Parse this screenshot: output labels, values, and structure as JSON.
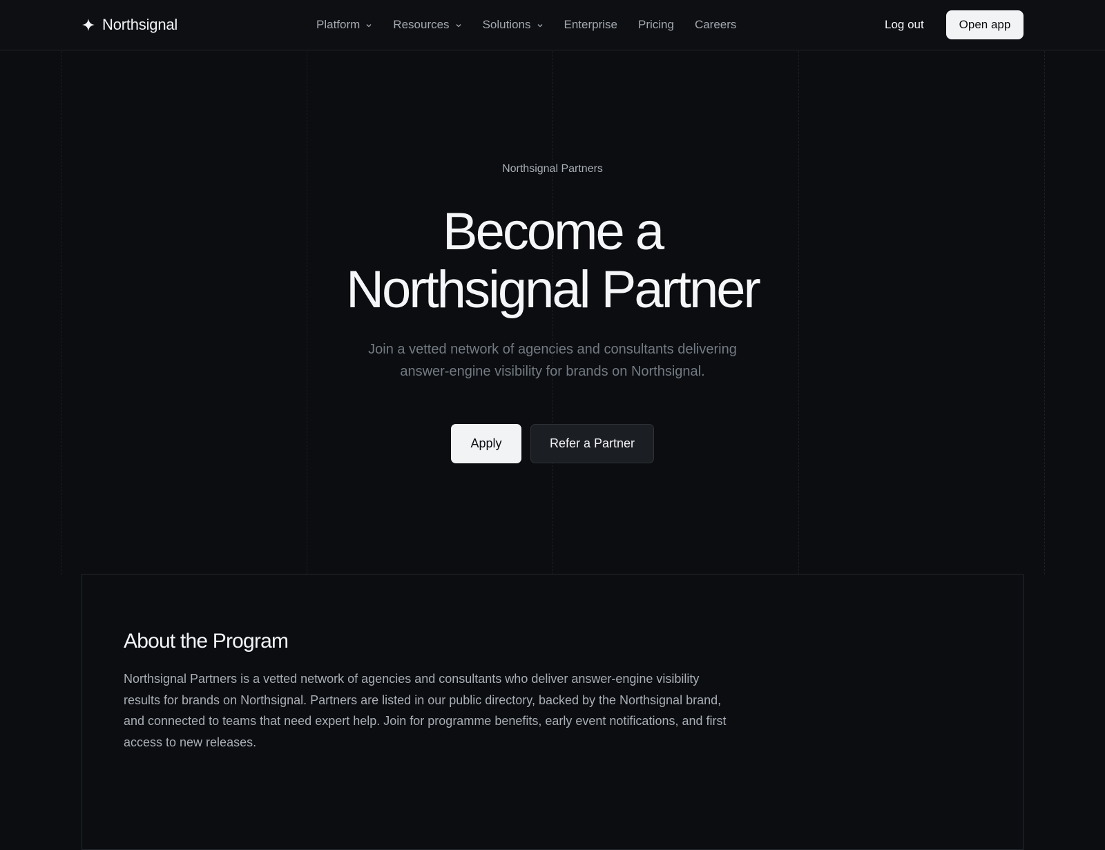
{
  "nav": {
    "brand": "Northsignal",
    "items": [
      {
        "label": "Platform",
        "has_dropdown": true
      },
      {
        "label": "Resources",
        "has_dropdown": true
      },
      {
        "label": "Solutions",
        "has_dropdown": true
      },
      {
        "label": "Enterprise",
        "has_dropdown": false
      },
      {
        "label": "Pricing",
        "has_dropdown": false
      },
      {
        "label": "Careers",
        "has_dropdown": false
      }
    ],
    "logout_label": "Log out",
    "open_app_label": "Open app"
  },
  "hero": {
    "eyebrow": "Northsignal Partners",
    "title_line1": "Become a",
    "title_line2": "Northsignal Partner",
    "subtitle_line1": "Join a vetted network of agencies and consultants delivering",
    "subtitle_line2": "answer-engine visibility for brands on Northsignal.",
    "apply_label": "Apply",
    "refer_label": "Refer a Partner"
  },
  "about": {
    "title": "About the Program",
    "body_lines": [
      "Northsignal Partners is a vetted network of agencies and consultants who deliver answer-engine visibility",
      "results for brands on Northsignal. Partners are listed in our public directory, backed by the Northsignal brand,",
      "and connected to teams that need expert help. Join for programme benefits, early event notifications, and first",
      "access to new releases."
    ]
  },
  "icons": {
    "brand": "sparkle-icon",
    "dropdown": "chevron-down-icon"
  },
  "colors": {
    "background": "#0b0d10",
    "primary_button": "#f2f3f5",
    "secondary_button": "#1b1e23",
    "muted_text": "#737a83"
  }
}
